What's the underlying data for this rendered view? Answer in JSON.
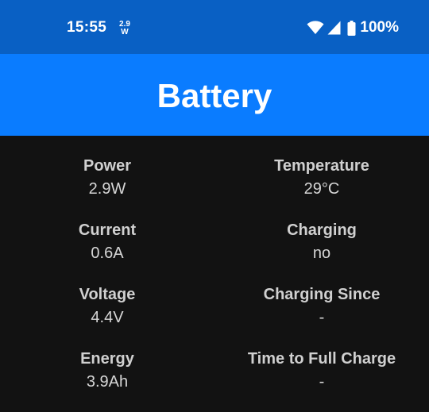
{
  "status_bar": {
    "time": "15:55",
    "power_top": "2.9",
    "power_bottom": "W",
    "battery_percent": "100%",
    "icons": [
      "wifi-icon",
      "signal-icon",
      "battery-icon"
    ]
  },
  "app_bar": {
    "title": "Battery"
  },
  "stats": {
    "power": {
      "label": "Power",
      "value": "2.9W"
    },
    "temperature": {
      "label": "Temperature",
      "value": "29°C"
    },
    "current": {
      "label": "Current",
      "value": "0.6A"
    },
    "charging": {
      "label": "Charging",
      "value": "no"
    },
    "voltage": {
      "label": "Voltage",
      "value": "4.4V"
    },
    "charging_since": {
      "label": "Charging Since",
      "value": "-"
    },
    "energy": {
      "label": "Energy",
      "value": "3.9Ah"
    },
    "time_to_full": {
      "label": "Time to Full Charge",
      "value": "-"
    }
  },
  "colors": {
    "status_bar_bg": "#0960c4",
    "app_bar_bg": "#0a7cff",
    "content_bg": "#121212",
    "text": "#d6d6d6"
  }
}
